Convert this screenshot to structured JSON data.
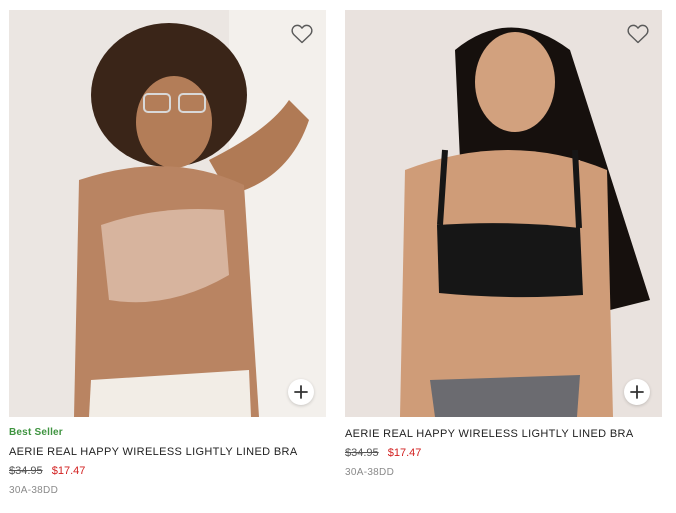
{
  "products": [
    {
      "badge": "Best Seller",
      "title": "AERIE REAL HAPPY WIRELESS LIGHTLY LINED BRA",
      "price_original": "$34.95",
      "price_sale": "$17.47",
      "sizes": "30A-38DD",
      "icons": {
        "favorite": "heart-outline-icon",
        "quick_add": "plus-icon"
      }
    },
    {
      "badge": "",
      "title": "AERIE REAL HAPPY WIRELESS LIGHTLY LINED BRA",
      "price_original": "$34.95",
      "price_sale": "$17.47",
      "sizes": "30A-38DD",
      "icons": {
        "favorite": "heart-outline-icon",
        "quick_add": "plus-icon"
      }
    }
  ],
  "colors": {
    "badge": "#3f9440",
    "sale_price": "#d21f1f",
    "original_price": "#555555",
    "sizes": "#8a8a8a"
  }
}
